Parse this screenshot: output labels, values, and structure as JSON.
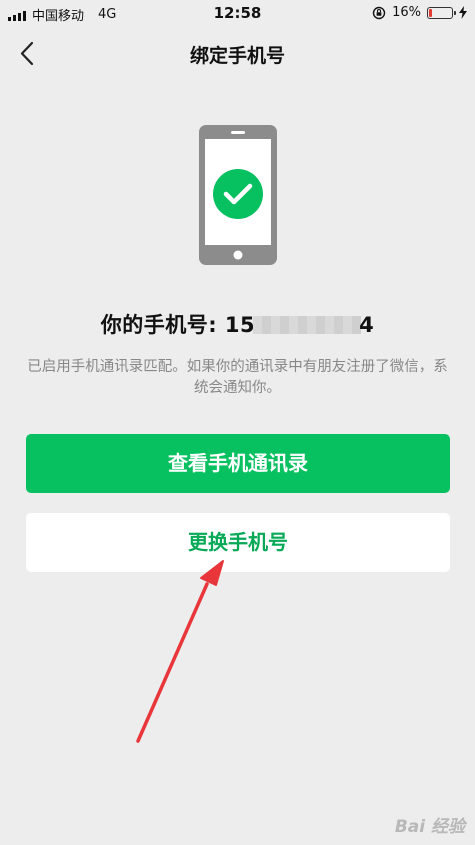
{
  "status_bar": {
    "carrier": "中国移动",
    "network": "4G",
    "time": "12:58",
    "battery_percent": "16%",
    "battery_level": 0.16,
    "battery_color": "#e23b33"
  },
  "nav": {
    "title": "绑定手机号",
    "back_icon": "chevron-left-icon"
  },
  "illustration": {
    "icon": "phone-check-icon",
    "phone_color": "#8c8c8c",
    "check_color": "#07c160"
  },
  "phone_info": {
    "label": "你的手机号: ",
    "number_prefix": "15",
    "number_suffix": "4"
  },
  "description": "已启用手机通讯录匹配。如果你的通讯录中有朋友注册了微信，系统会通知你。",
  "buttons": {
    "view_contacts": "查看手机通讯录",
    "change_number": "更换手机号"
  },
  "annotation": {
    "arrow_color": "#e8363a"
  },
  "watermark": "Bai 经验"
}
